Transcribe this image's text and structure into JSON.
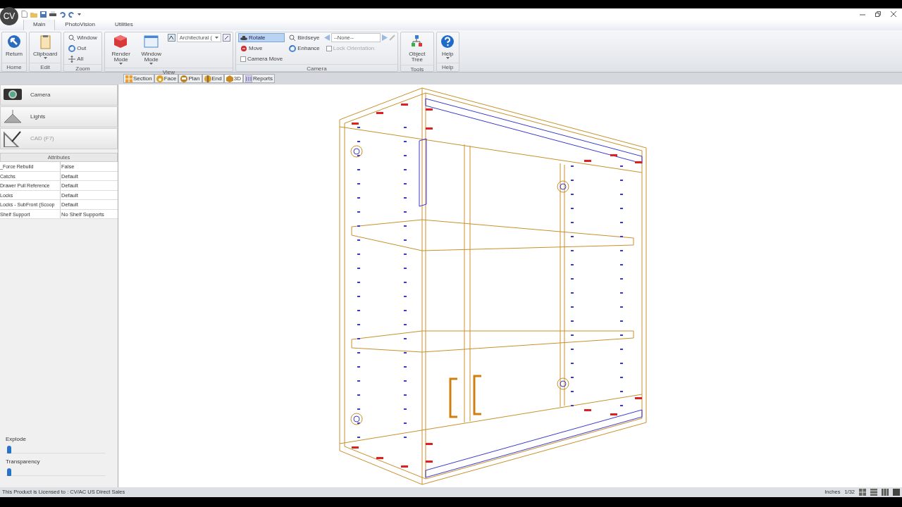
{
  "app_badge": "CV",
  "ribbon_tabs": [
    {
      "label": "Main",
      "selected": true
    },
    {
      "label": "PhotoVision",
      "selected": false
    },
    {
      "label": "Utilities",
      "selected": false
    }
  ],
  "ribbon_groups": [
    {
      "title": "Home",
      "items": [
        {
          "kind": "large",
          "label": "Return"
        }
      ]
    },
    {
      "title": "Edit",
      "items": [
        {
          "kind": "large",
          "label": "Clipboard",
          "dropdown": true
        }
      ]
    },
    {
      "title": "Zoom",
      "items": [
        {
          "kind": "small",
          "label": "Window"
        },
        {
          "kind": "small",
          "label": "Out"
        },
        {
          "kind": "small",
          "label": "All"
        }
      ]
    },
    {
      "title": "View",
      "items": [
        {
          "kind": "large",
          "label": "Render Mode",
          "dropdown": true
        },
        {
          "kind": "large",
          "label": "Window Mode",
          "dropdown": true
        },
        {
          "kind": "combo",
          "value": "Architectural ("
        }
      ]
    },
    {
      "title": "Camera",
      "items": [
        {
          "kind": "small",
          "label": "Rotate",
          "selected": true
        },
        {
          "kind": "small",
          "label": "Move",
          "selected": false
        },
        {
          "kind": "check",
          "label": "Camera Move",
          "checked": false,
          "disabled": false
        },
        {
          "kind": "small",
          "label": "Birdseye",
          "selected": false
        },
        {
          "kind": "small",
          "label": "Enhance",
          "selected": false
        },
        {
          "kind": "nav",
          "value": "--None--"
        },
        {
          "kind": "check",
          "label": "Lock Orientation",
          "checked": false,
          "disabled": true
        }
      ]
    },
    {
      "title": "Tools",
      "items": [
        {
          "kind": "large",
          "label": "Object Tree"
        }
      ]
    },
    {
      "title": "Help",
      "items": [
        {
          "kind": "large",
          "label": "Help",
          "dropdown": true
        }
      ]
    }
  ],
  "view_tabs": [
    {
      "label": "Section",
      "selected": false
    },
    {
      "label": "Face",
      "selected": false
    },
    {
      "label": "Plan",
      "selected": false
    },
    {
      "label": "End",
      "selected": false
    },
    {
      "label": "3D",
      "selected": true
    },
    {
      "label": "Reports",
      "selected": false
    }
  ],
  "side_buttons": [
    {
      "label": "Camera",
      "disabled": false
    },
    {
      "label": "Lights",
      "disabled": false
    },
    {
      "label": "CAD (F7)",
      "disabled": true
    }
  ],
  "attributes": {
    "title": "Attributes",
    "rows": [
      {
        "name": "_Force Rebuild",
        "value": "False"
      },
      {
        "name": "Catchs",
        "value": "Default"
      },
      {
        "name": "Drawer Pull Reference",
        "value": "Default"
      },
      {
        "name": "Locks",
        "value": "Default"
      },
      {
        "name": "Locks - SubFront (Scoop",
        "value": "Default"
      },
      {
        "name": "Shelf Support",
        "value": "No Shelf Supports"
      }
    ]
  },
  "sliders": [
    {
      "label": "Explode",
      "level": 0
    },
    {
      "label": "Transparency",
      "level": 0
    }
  ],
  "status_bar": {
    "license": "This Product is Licensed to : CV/AC US Direct Sales",
    "units": "Inches",
    "precision": "1/32"
  }
}
